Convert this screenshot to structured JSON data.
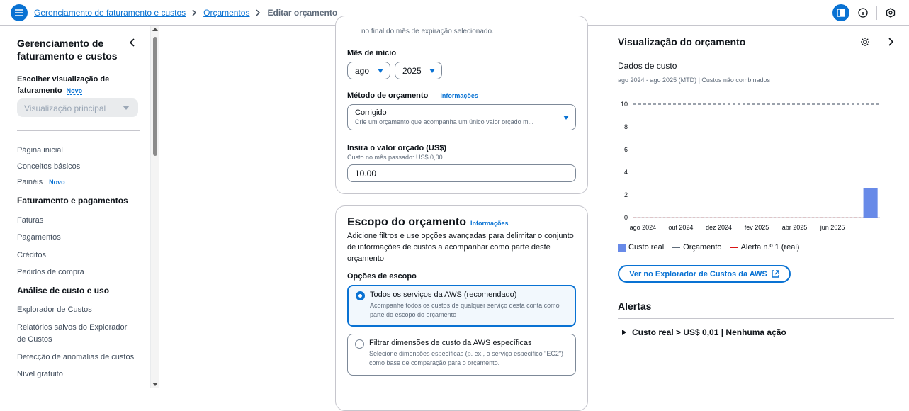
{
  "breadcrumb": {
    "items": [
      "Gerenciamento de faturamento e custos",
      "Orçamentos"
    ],
    "current": "Editar orçamento"
  },
  "sidebar": {
    "title": "Gerenciamento de faturamento e custos",
    "choose_view_label": "Escolher visualização de faturamento",
    "new_badge": "Novo",
    "view_select_value": "Visualização principal",
    "links_top": [
      "Página inicial",
      "Conceitos básicos",
      "Painéis"
    ],
    "section_billing": "Faturamento e pagamentos",
    "links_billing": [
      "Faturas",
      "Pagamentos",
      "Créditos",
      "Pedidos de compra"
    ],
    "section_cost": "Análise de custo e uso",
    "links_cost": [
      "Explorador de Custos",
      "Relatórios salvos do Explorador de Custos",
      "Detecção de anomalias de custos",
      "Nível gratuito"
    ]
  },
  "form": {
    "partial_text": "no final do mês de expiração selecionado.",
    "start_month_label": "Mês de início",
    "start_month": "ago",
    "start_year": "2025",
    "method_label": "Método de orçamento",
    "info_link": "Informações",
    "method_value": "Corrigido",
    "method_desc": "Crie um orçamento que acompanha um único valor orçado m...",
    "amount_label": "Insira o valor orçado (US$)",
    "amount_desc": "Custo no mês passado: US$ 0,00",
    "amount_value": "10.00"
  },
  "scope": {
    "title": "Escopo do orçamento",
    "info_link": "Informações",
    "desc": "Adicione filtros e use opções avançadas para delimitar o conjunto de informações de custos a acompanhar como parte deste orçamento",
    "options_label": "Opções de escopo",
    "option1_title": "Todos os serviços da AWS (recomendado)",
    "option1_desc": "Acompanhe todos os custos de qualquer serviço desta conta como parte do escopo do orçamento",
    "option2_title": "Filtrar dimensões de custo da AWS específicas",
    "option2_desc": "Selecione dimensões específicas (p. ex., o serviço específico \"EC2\") como base de comparação para o orçamento."
  },
  "preview": {
    "title": "Visualização do orçamento",
    "subtitle": "Dados de custo",
    "range": "ago 2024 - ago 2025 (MTD) | Custos não combinados",
    "legend_actual": "Custo real",
    "legend_budget": "Orçamento",
    "legend_alert": "Alerta n.º 1 (real)",
    "explorer_button": "Ver no Explorador de Custos da AWS",
    "alerts_title": "Alertas",
    "alert_row": "Custo real > US$ 0,01 | Nenhuma ação"
  },
  "colors": {
    "accent": "#0972d3",
    "bar": "#688ae8",
    "budget_line": "#5f6b7a",
    "alert_line": "#d91515"
  },
  "chart_data": {
    "type": "bar",
    "categories": [
      "ago 2024",
      "set 2024",
      "out 2024",
      "nov 2024",
      "dez 2024",
      "jan 2025",
      "fev 2025",
      "mar 2025",
      "abr 2025",
      "mai 2025",
      "jun 2025",
      "jul 2025",
      "ago 2025"
    ],
    "tick_labels": [
      "ago 2024",
      "out 2024",
      "dez 2024",
      "fev 2025",
      "abr 2025",
      "jun 2025"
    ],
    "series": [
      {
        "name": "Custo real",
        "values": [
          0,
          0,
          0,
          0,
          0,
          0,
          0,
          0,
          0,
          0,
          0,
          0,
          2.6
        ]
      }
    ],
    "budget": 10,
    "alert_threshold": 0.01,
    "yticks": [
      0,
      2,
      4,
      6,
      8,
      10
    ],
    "ylim": [
      0,
      10
    ]
  }
}
